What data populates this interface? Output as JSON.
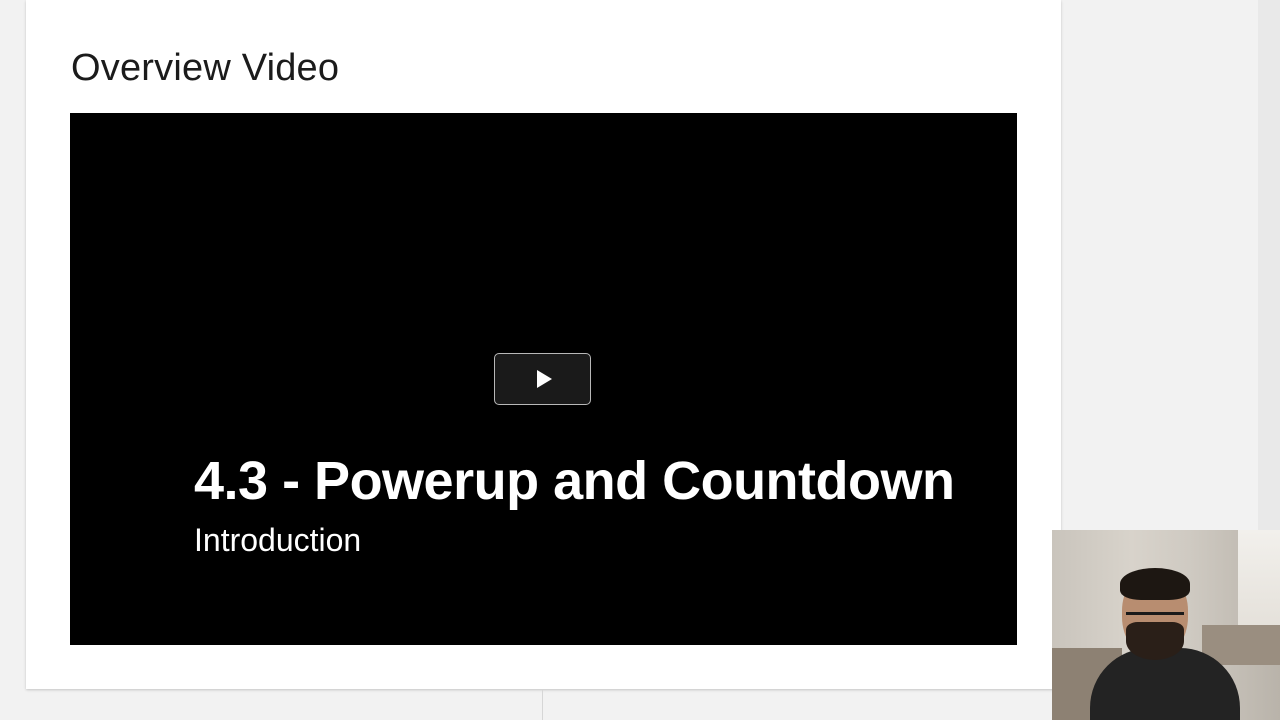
{
  "section": {
    "title": "Overview Video"
  },
  "video": {
    "title": "4.3 - Powerup and Countdown",
    "subtitle": "Introduction",
    "play_icon": "play-icon"
  },
  "colors": {
    "page_background": "#f2f2f2",
    "card_background": "#ffffff",
    "video_background": "#000000",
    "heading_text": "#1b1b1b",
    "video_text": "#ffffff"
  }
}
